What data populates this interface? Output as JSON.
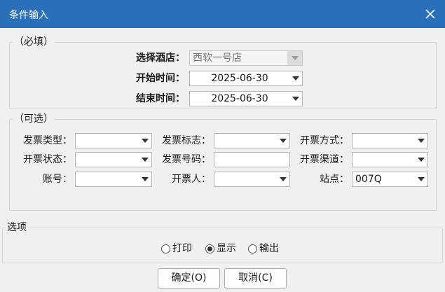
{
  "dialog": {
    "title": "条件输入"
  },
  "required": {
    "legend": "（必填）",
    "hotel": {
      "label": "选择酒店：",
      "value": "西软一号店"
    },
    "start": {
      "label": "开始时间：",
      "value": "2025-06-30"
    },
    "end": {
      "label": "结束时间：",
      "value": "2025-06-30"
    }
  },
  "optional": {
    "legend": "（可选）",
    "invoice_type": {
      "label": "发票类型：",
      "value": ""
    },
    "invoice_flag": {
      "label": "发票标志：",
      "value": ""
    },
    "issue_method": {
      "label": "开票方式：",
      "value": ""
    },
    "issue_status": {
      "label": "开票状态：",
      "value": ""
    },
    "invoice_number": {
      "label": "发票号码：",
      "value": ""
    },
    "issue_channel": {
      "label": "开票渠道：",
      "value": ""
    },
    "account": {
      "label": "账号：",
      "value": ""
    },
    "issuer": {
      "label": "开票人：",
      "value": ""
    },
    "station": {
      "label": "站点：",
      "value": "007Q"
    }
  },
  "options": {
    "legend": "选项",
    "radios": [
      {
        "label": "打印",
        "checked": false
      },
      {
        "label": "显示",
        "checked": true
      },
      {
        "label": "输出",
        "checked": false
      }
    ]
  },
  "buttons": {
    "ok": "确定(O)",
    "cancel": "取消(C)"
  },
  "colors": {
    "titlebar": "#2a6fb9",
    "background": "#f0f0f0"
  },
  "icons": {
    "close": "close-icon",
    "dropdown": "chevron-down-icon"
  }
}
